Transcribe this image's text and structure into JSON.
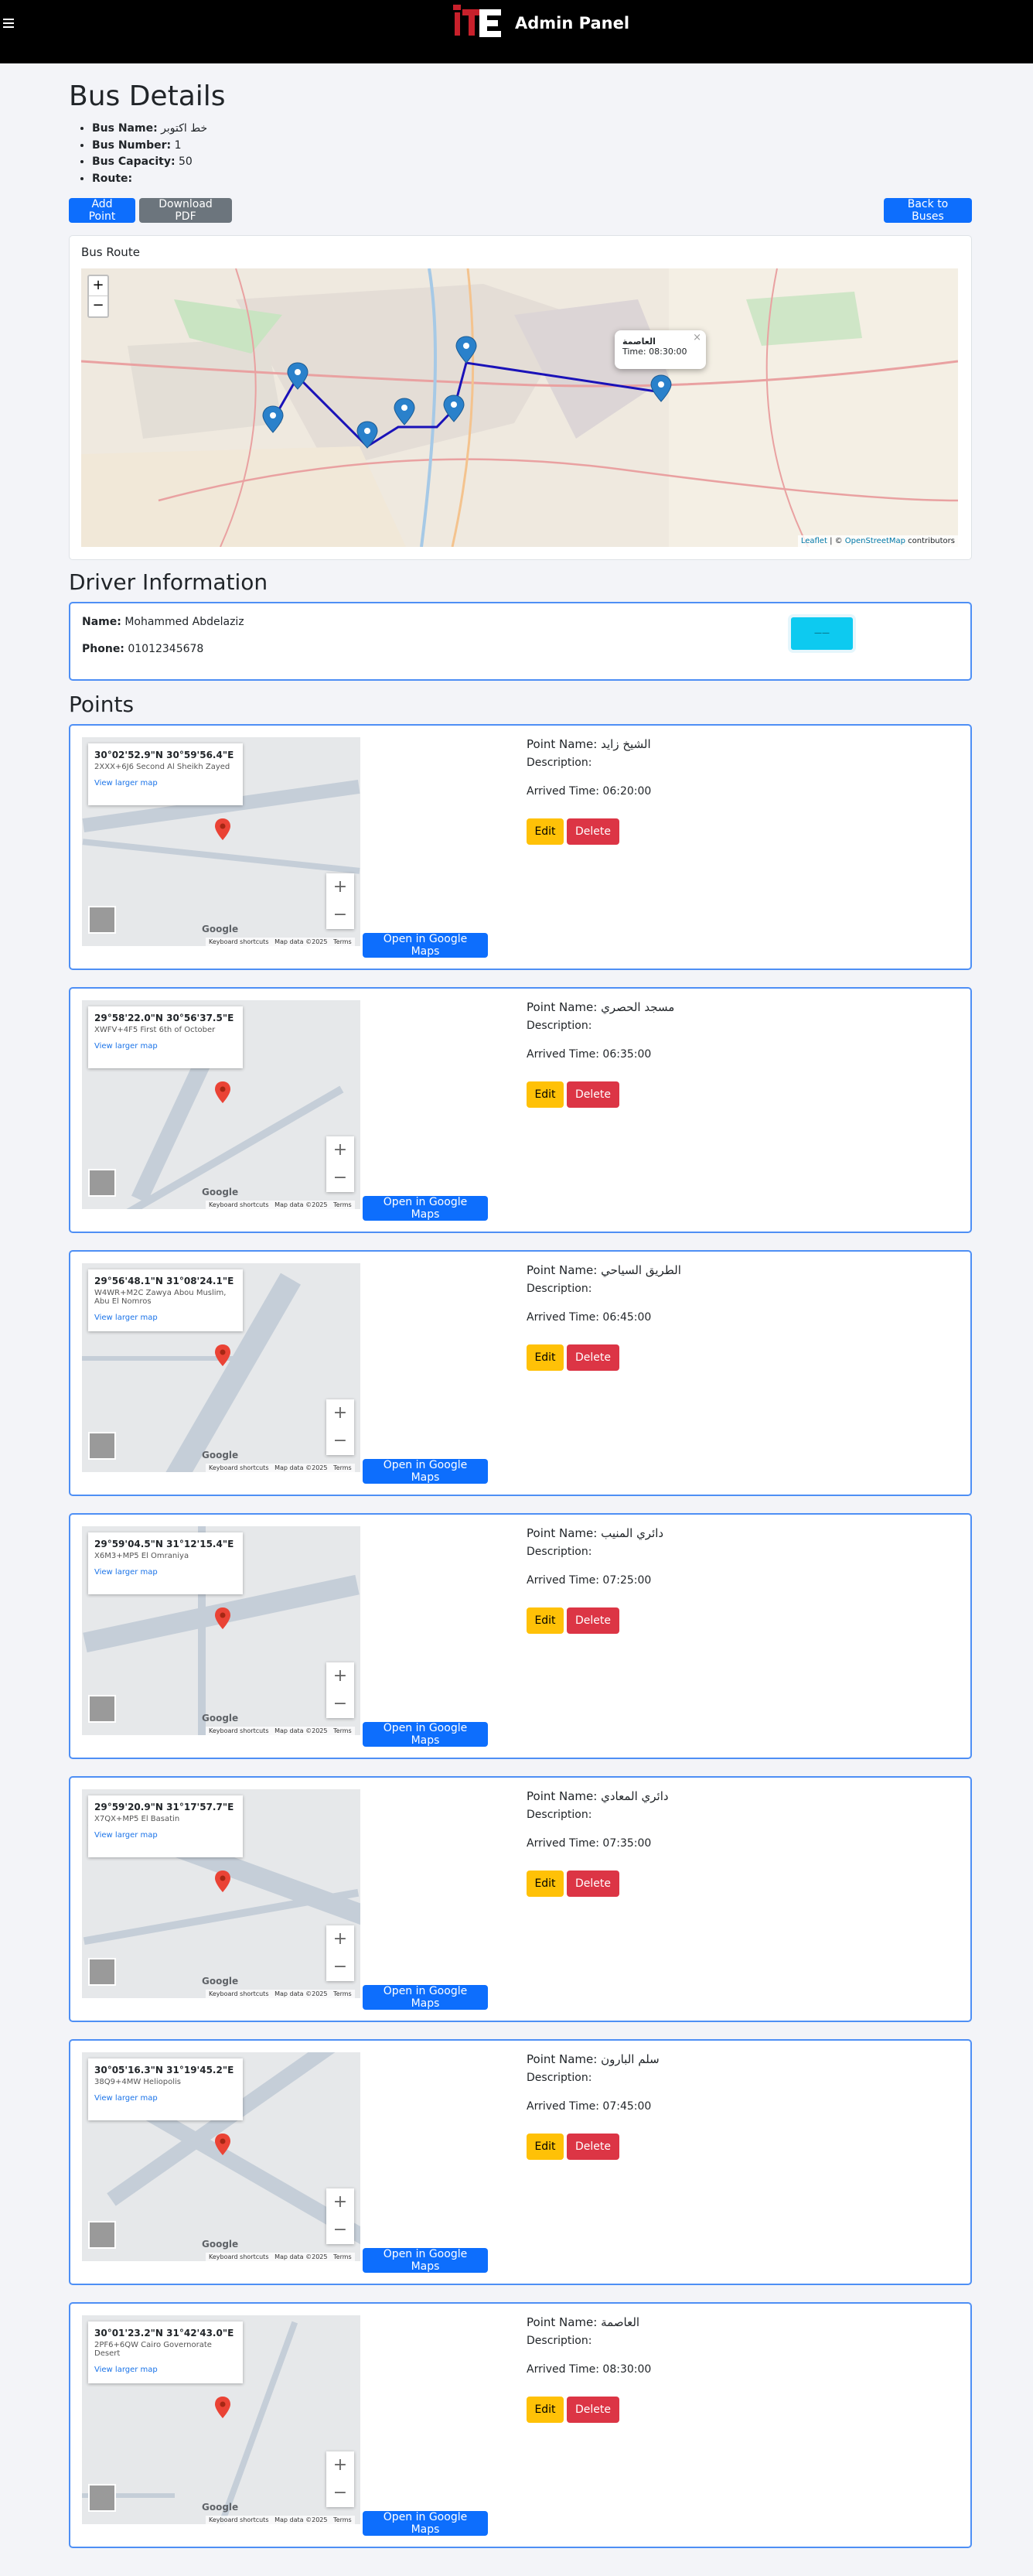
{
  "header": {
    "brand": "Admin Panel",
    "logo_text": "ITE"
  },
  "page": {
    "title": "Bus Details"
  },
  "bus": [
    {
      "label": "Bus Name:",
      "value": "خط اكتوبر"
    },
    {
      "label": "Bus Number:",
      "value": "1"
    },
    {
      "label": "Bus Capacity:",
      "value": "50"
    },
    {
      "label": "Route:",
      "value": ""
    }
  ],
  "actions": {
    "add_point": "Add Point",
    "download_pdf": "Download PDF",
    "back": "Back to Buses"
  },
  "route": {
    "title": "Bus Route",
    "zoom_in": "+",
    "zoom_out": "−",
    "popup_title": "العاصمة",
    "popup_time": "Time: 08:30:00",
    "popup_close": "×",
    "attribution_leaflet": "Leaflet",
    "attribution_sep": " | © ",
    "attribution_osm": "OpenStreetMap",
    "attribution_tail": " contributors"
  },
  "driver": {
    "section_title": "Driver Information",
    "name_label": "Name:",
    "name": "Mohammed Abdelaziz",
    "phone_label": "Phone:",
    "phone": "01012345678",
    "button_label": "——"
  },
  "points_section": {
    "title": "Points"
  },
  "labels": {
    "point_name": "Point Name:",
    "description": "Description:",
    "arrived": "Arrived Time:",
    "edit": "Edit",
    "delete": "Delete",
    "open_maps": "Open in Google Maps",
    "view_larger": "View larger map",
    "keyboard": "Keyboard shortcuts",
    "map_data": "Map data ©2025",
    "terms": "Terms",
    "google": "Google"
  },
  "points": [
    {
      "name": "الشيخ زايد",
      "time": "06:20:00",
      "coord": "30°02'52.9\"N 30°59'56.4\"E",
      "addr": "2XXX+6J6 Second Al Sheikh Zayed"
    },
    {
      "name": "مسجد الحصري",
      "time": "06:35:00",
      "coord": "29°58'22.0\"N 30°56'37.5\"E",
      "addr": "XWFV+4F5 First 6th of October"
    },
    {
      "name": "الطريق السياحي",
      "time": "06:45:00",
      "coord": "29°56'48.1\"N 31°08'24.1\"E",
      "addr": "W4WR+M2C Zawya Abou Muslim, Abu El Nomros"
    },
    {
      "name": "دائري المنيب",
      "time": "07:25:00",
      "coord": "29°59'04.5\"N 31°12'15.4\"E",
      "addr": "X6M3+MP5 El Omraniya"
    },
    {
      "name": "دائري المعادي",
      "time": "07:35:00",
      "coord": "29°59'20.9\"N 31°17'57.7\"E",
      "addr": "X7QX+MP5 El Basatin"
    },
    {
      "name": "سلم البارون",
      "time": "07:45:00",
      "coord": "30°05'16.3\"N 31°19'45.2\"E",
      "addr": "38Q9+4MW Heliopolis"
    },
    {
      "name": "العاصمة",
      "time": "08:30:00",
      "coord": "30°01'23.2\"N 31°42'43.0\"E",
      "addr": "2PF6+6QW Cairo Governorate Desert"
    }
  ]
}
